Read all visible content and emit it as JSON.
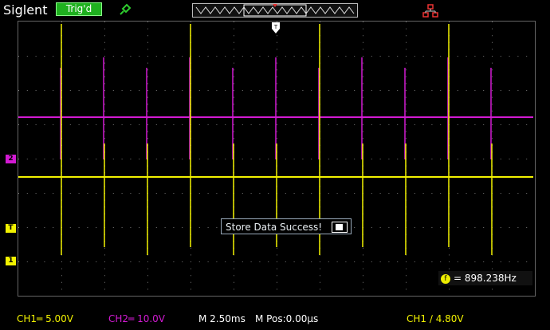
{
  "header": {
    "brand": "Siglent",
    "trigger_status": "Trig'd",
    "probe_icon": "probe-icon",
    "network_icon": "network-icon"
  },
  "markers": {
    "ch2": "2",
    "trigger": "T",
    "ch1": "1"
  },
  "message": {
    "text": "Store Data Success!"
  },
  "measure": {
    "freq_badge": "f",
    "frequency": "= 898.238Hz"
  },
  "status": {
    "ch1": "CH1═ 5.00V",
    "ch2": "CH2═ 10.0V",
    "timebase": "M 2.50ms",
    "mpos": "M Pos:0.00µs",
    "trigger": "CH1 ∕ 4.80V"
  },
  "colors": {
    "ch1": "#f2f200",
    "ch2": "#d21ad2",
    "trig_badge": "#1fb01f"
  }
}
